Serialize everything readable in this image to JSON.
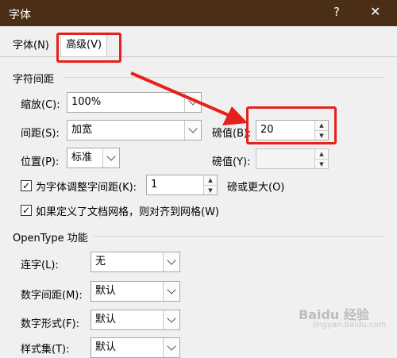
{
  "window": {
    "title": "字体",
    "help_icon": "?",
    "close_icon": "✕"
  },
  "tabs": [
    {
      "label": "字体(N)"
    },
    {
      "label": "高级(V)"
    }
  ],
  "char_spacing": {
    "section_title": "字符间距",
    "scale": {
      "label": "缩放(C):",
      "value": "100%"
    },
    "spacing": {
      "label": "间距(S):",
      "value": "加宽",
      "by_label": "磅值(B):",
      "by_value": "20"
    },
    "position": {
      "label": "位置(P):",
      "value": "标准",
      "by_label": "磅值(Y):",
      "by_value": ""
    },
    "kerning": {
      "label": "为字体调整字间距(K):",
      "value": "1",
      "suffix": "磅或更大(O)",
      "checked": true
    },
    "snap_grid": {
      "label": "如果定义了文档网格，则对齐到网格(W)",
      "checked": true
    }
  },
  "opentype": {
    "section_title": "OpenType 功能",
    "ligatures": {
      "label": "连字(L):",
      "value": "无"
    },
    "number_spacing": {
      "label": "数字间距(M):",
      "value": "默认"
    },
    "number_forms": {
      "label": "数字形式(F):",
      "value": "默认"
    },
    "stylistic_sets": {
      "label": "样式集(T):",
      "value": "默认"
    }
  },
  "watermark": {
    "text": "Baidu 经验",
    "url": "jingyan.baidu.com"
  },
  "accent": {
    "highlight": "#e8201c",
    "titlebar": "#4a2e15"
  }
}
